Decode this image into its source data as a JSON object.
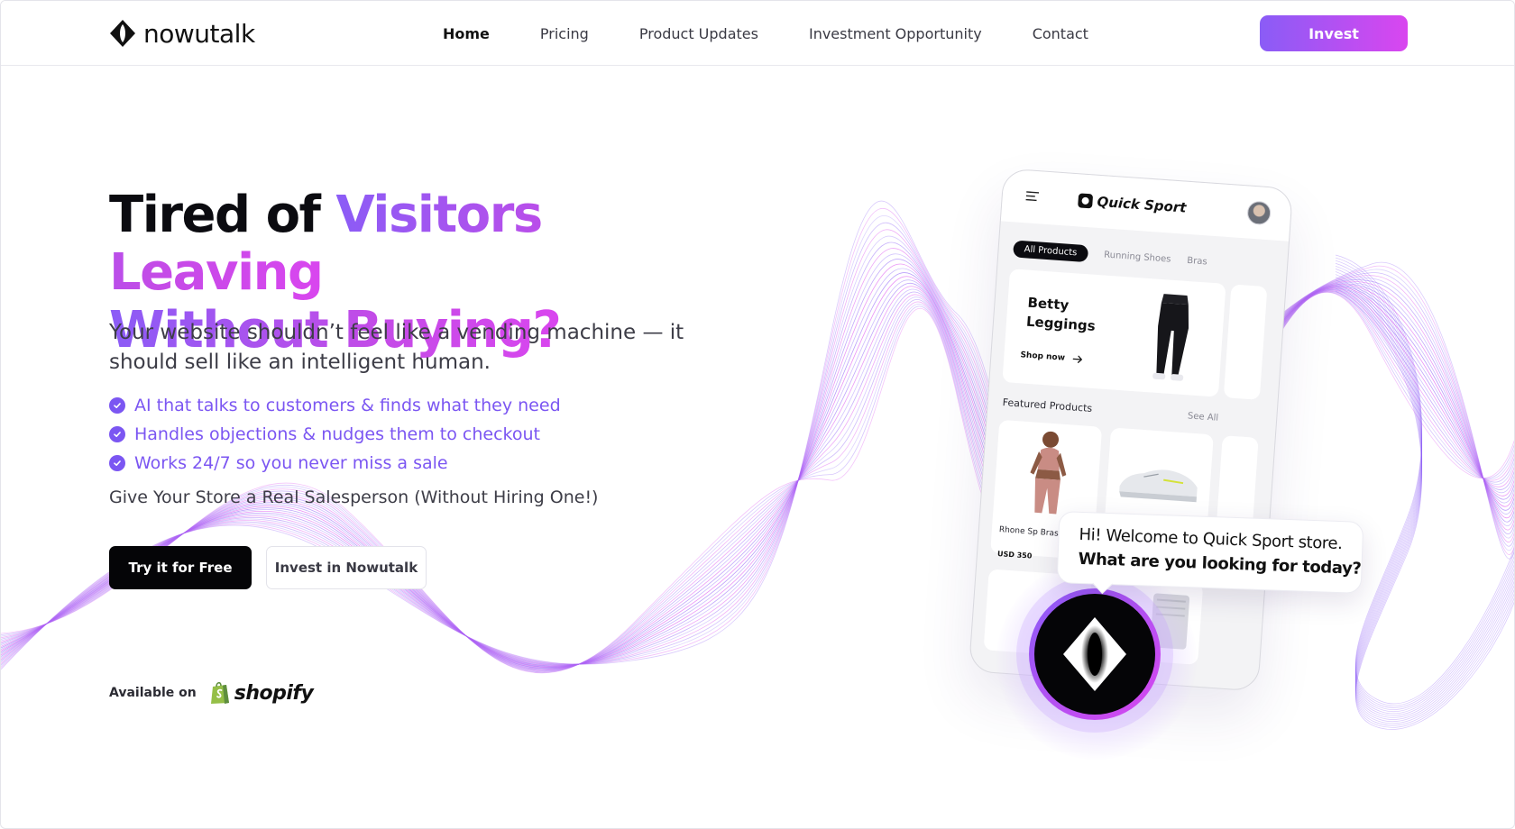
{
  "brand": {
    "name": "nowutalk"
  },
  "nav": {
    "items": [
      {
        "label": "Home",
        "active": true
      },
      {
        "label": "Pricing",
        "active": false
      },
      {
        "label": "Product Updates",
        "active": false
      },
      {
        "label": "Investment Opportunity",
        "active": false
      },
      {
        "label": "Contact",
        "active": false
      }
    ],
    "cta": "Invest"
  },
  "hero": {
    "title_plain": "Tired of ",
    "title_grad_1": "Visitors Leaving",
    "title_grad_2": "Without Buying?",
    "subtitle": "Your website shouldn’t feel like a vending machine — it should sell like an intelligent human.",
    "features": [
      "AI that talks to customers & finds what they need",
      "Handles objections & nudges them to checkout",
      "Works 24/7 so you never miss a sale"
    ],
    "tagline": "Give Your Store a Real Salesperson (Without Hiring One!)",
    "primary_cta": "Try it for Free",
    "secondary_cta": "Invest in Nowutalk",
    "available_label": "Available on",
    "platform": "shopify"
  },
  "phone": {
    "store_name": "Quick Sport",
    "categories": [
      "All Products",
      "Running Shoes",
      "Bras"
    ],
    "promo": {
      "title": "Betty Leggings",
      "cta": "Shop now"
    },
    "featured_label": "Featured Products",
    "see_all": "See All",
    "products": [
      {
        "name": "Rhone Sp Bras",
        "price": "USD 350"
      }
    ]
  },
  "chat": {
    "line1": "Hi! Welcome to Quick Sport store.",
    "line2": "What are you looking for today?"
  },
  "colors": {
    "accent_start": "#8b5cf6",
    "accent_end": "#d946ef",
    "primary_button": "#050507",
    "feature_text": "#7b56f2"
  }
}
